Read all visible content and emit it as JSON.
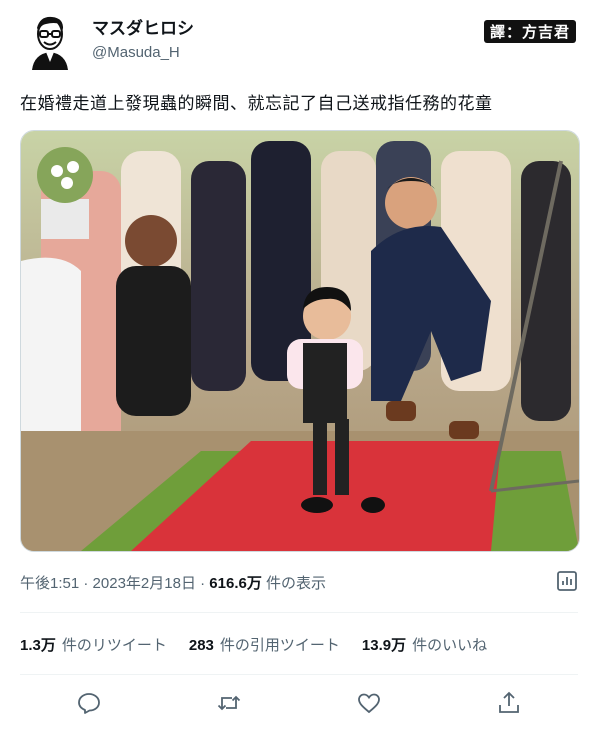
{
  "user": {
    "display_name": "マスダヒロシ",
    "handle": "@Masuda_H"
  },
  "credit": "譯：方吉君",
  "tweet": {
    "text": "在婚禮走道上發現蟲的瞬間、就忘記了自己送戒指任務的花童"
  },
  "meta": {
    "time": "午後1:51",
    "sep1": " · ",
    "date": "2023年2月18日",
    "sep2": " · ",
    "views_count": "616.6万",
    "views_label": " 件の表示"
  },
  "stats": [
    {
      "num": "1.3万",
      "label": "件のリツイート"
    },
    {
      "num": "283",
      "label": "件の引用ツイート"
    },
    {
      "num": "13.9万",
      "label": "件のいいね"
    }
  ],
  "icons": {
    "avatar": "avatar-illustration",
    "analytics": "analytics-icon",
    "reply": "reply-icon",
    "retweet": "retweet-icon",
    "like": "heart-icon",
    "share": "share-icon"
  },
  "colors": {
    "text": "#0f1419",
    "secondary": "#536471",
    "carpet": "#d9333a",
    "grass": "#6f9e3a"
  }
}
